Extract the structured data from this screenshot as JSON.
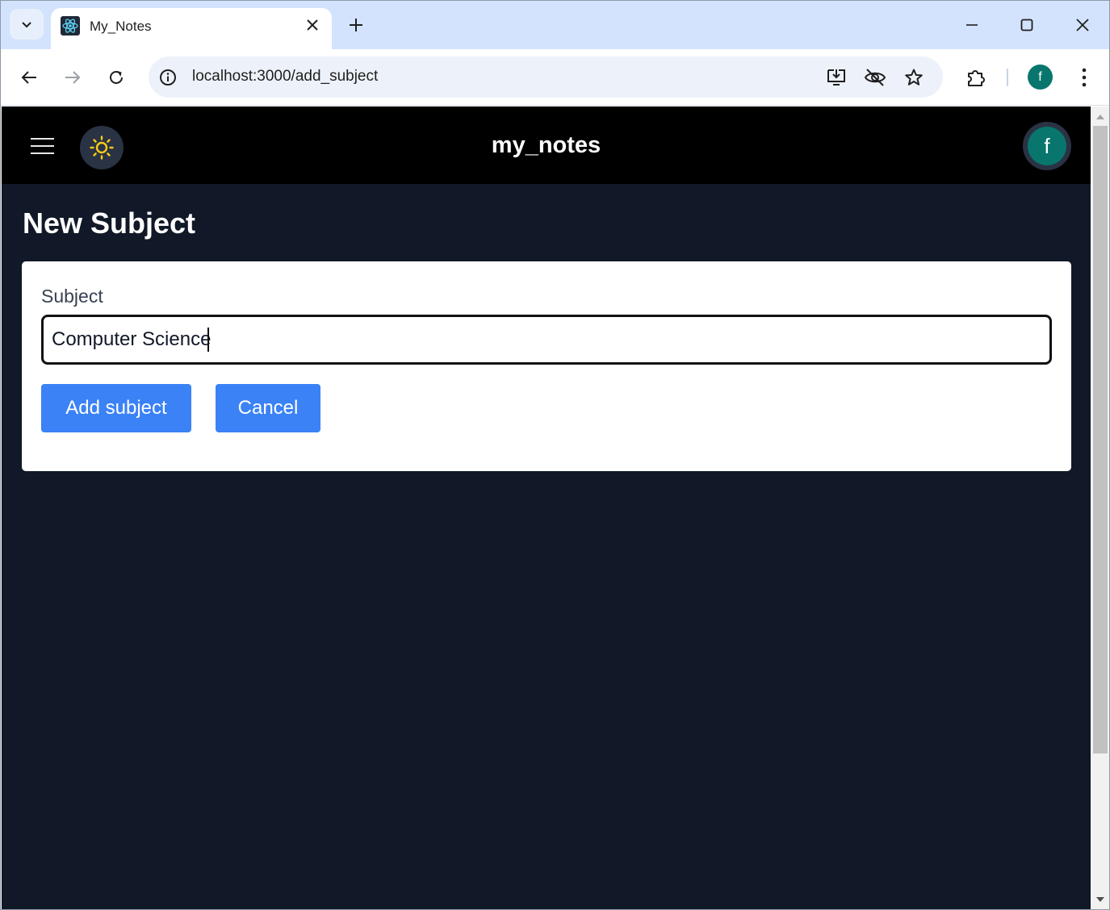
{
  "browser": {
    "tab_title": "My_Notes",
    "url": "localhost:3000/add_subject",
    "profile_initial": "f",
    "icons": [
      "tab-search-icon",
      "react-favicon-icon",
      "close-icon",
      "plus-icon",
      "minimize-icon",
      "maximize-icon",
      "close-window-icon",
      "back-icon",
      "forward-icon",
      "reload-icon",
      "site-info-icon",
      "install-app-icon",
      "eye-off-icon",
      "star-icon",
      "extensions-icon",
      "more-vert-icon"
    ]
  },
  "app": {
    "title": "my_notes",
    "user_initial": "f",
    "theme_icon": "sun-icon",
    "menu_icon": "hamburger-icon"
  },
  "page": {
    "heading": "New Subject",
    "form": {
      "label": "Subject",
      "value": "Computer Science",
      "add_button": "Add subject",
      "cancel_button": "Cancel"
    }
  },
  "colors": {
    "page_bg": "#111827",
    "appbar_bg": "#000000",
    "button_blue": "#3b82f6",
    "avatar_teal": "#08766c",
    "sun_yellow": "#facc15",
    "tabstrip_bg": "#d3e3fd"
  }
}
